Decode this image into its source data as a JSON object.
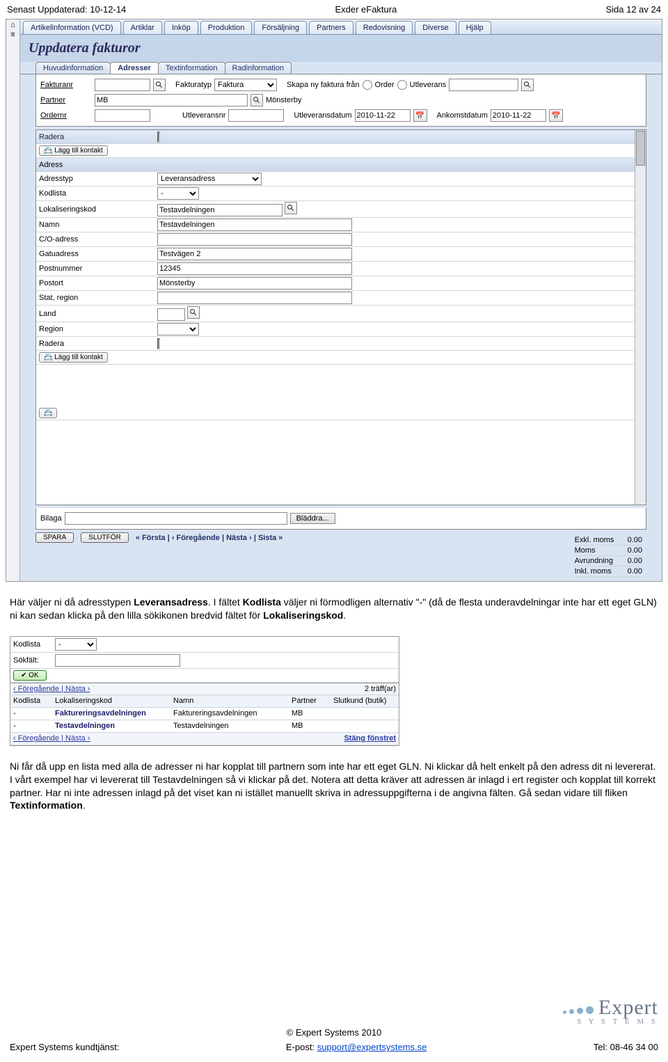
{
  "header": {
    "left": "Senast Uppdaterad: 10-12-14",
    "center": "Exder eFaktura",
    "right": "Sida 12 av 24"
  },
  "top_tabs": [
    "Artikelinformation (VCD)",
    "Artiklar",
    "Inköp",
    "Produktion",
    "Försäljning",
    "Partners",
    "Redovisning",
    "Diverse",
    "Hjälp"
  ],
  "page_title": "Uppdatera fakturor",
  "sub_tabs": [
    {
      "label": "Huvudinformation",
      "active": false
    },
    {
      "label": "Adresser",
      "active": true
    },
    {
      "label": "Textinformation",
      "active": false
    },
    {
      "label": "Radinformation",
      "active": false
    }
  ],
  "form": {
    "fakturanr_label": "Fakturanr",
    "fakturanr_value": "",
    "fakturatyp_label": "Fakturatyp",
    "fakturatyp_value": "Faktura",
    "skapa_label": "Skapa ny faktura från",
    "order_label": "Order",
    "utleverans_opt_label": "Utleverans",
    "partner_label": "Partner",
    "partner_value": "MB",
    "partner_name": "Mönsterby",
    "ordernr_label": "Ordernr",
    "ordernr_value": "",
    "utleveransnr_label": "Utleveransnr",
    "utleveransnr_value": "",
    "utleveransdatum_label": "Utleveransdatum",
    "utleveransdatum_value": "2010-11-22",
    "ankomstdatum_label": "Ankomstdatum",
    "ankomstdatum_value": "2010-11-22"
  },
  "grid": {
    "radera_label": "Radera",
    "lagg_till_kontakt": "Lägg till kontakt",
    "adress_header": "Adress",
    "rows": [
      {
        "label": "Adresstyp",
        "value": "Leveransadress",
        "type": "select"
      },
      {
        "label": "Kodlista",
        "value": "-",
        "type": "select-narrow"
      },
      {
        "label": "Lokaliseringskod",
        "value": "Testavdelningen",
        "type": "text-mag"
      },
      {
        "label": "Namn",
        "value": "Testavdelningen",
        "type": "text"
      },
      {
        "label": "C/O-adress",
        "value": "",
        "type": "text"
      },
      {
        "label": "Gatuadress",
        "value": "Testvägen 2",
        "type": "text"
      },
      {
        "label": "Postnummer",
        "value": "12345",
        "type": "text"
      },
      {
        "label": "Postort",
        "value": "Mönsterby",
        "type": "text"
      },
      {
        "label": "Stat, region",
        "value": "",
        "type": "text"
      },
      {
        "label": "Land",
        "value": "",
        "type": "text-mag-narrow"
      },
      {
        "label": "Region",
        "value": "",
        "type": "select-narrow"
      },
      {
        "label": "Radera",
        "value": "",
        "type": "check"
      }
    ]
  },
  "bilaga": {
    "label": "Bilaga",
    "browse": "Bläddra..."
  },
  "totals": [
    {
      "label": "Exkl. moms",
      "value": "0.00"
    },
    {
      "label": "Moms",
      "value": "0.00"
    },
    {
      "label": "Avrundning",
      "value": "0.00"
    },
    {
      "label": "Inkl. moms",
      "value": "0.00"
    }
  ],
  "bottom": {
    "spara": "SPARA",
    "slutfor": "SLUTFÖR",
    "nav": "« Första | ‹ Föregående | Nästa › | Sista »"
  },
  "body_text": {
    "p1a": "Här väljer ni då adresstypen ",
    "p1b_bold": "Leveransadress",
    "p1c": ". I fältet ",
    "p1d_bold": "Kodlista",
    "p1e": " väljer ni förmodligen alternativ \"-\" (då de flesta underavdelningar inte har ett eget GLN) ni kan sedan klicka på den lilla sökikonen bredvid fältet för ",
    "p1f_bold": "Lokaliseringskod",
    "p1g": "."
  },
  "popup": {
    "kodlista_label": "Kodlista",
    "kodlista_value": "-",
    "sokfalt_label": "Sökfält:",
    "ok": "OK",
    "nav": "‹ Föregående | Nästa ›",
    "hits": "2 träff(ar)",
    "cols": [
      "Kodlista",
      "Lokaliseringskod",
      "Namn",
      "Partner",
      "Slutkund (butik)"
    ],
    "rows": [
      {
        "kodlista": "-",
        "lok": "Faktureringsavdelningen",
        "namn": "Faktureringsavdelningen",
        "partner": "MB",
        "slut": ""
      },
      {
        "kodlista": "-",
        "lok": "Testavdelningen",
        "namn": "Testavdelningen",
        "partner": "MB",
        "slut": ""
      }
    ],
    "close": "Stäng fönstret"
  },
  "body_text2": {
    "p1": "Ni får då upp en lista med alla de adresser ni har kopplat till partnern som inte har ett eget GLN. Ni klickar då helt enkelt på den adress dit ni levererat. I vårt exempel har vi levererat till Testavdelningen så vi klickar på det. Notera att detta kräver att adressen är inlagd i ert register och kopplat till korrekt partner. Har ni inte adressen inlagd på det viset kan ni istället manuellt skriva in adressuppgifterna i de angivna fälten. Gå sedan vidare till fliken ",
    "p1_bold": "Textinformation",
    "p1_end": "."
  },
  "footer": {
    "copyright": "© Expert Systems 2010",
    "left": "Expert Systems kundtjänst:",
    "mid_label": "E-post: ",
    "mid_link": "support@expertsystems.se",
    "right": "Tel: 08-46 34 00",
    "logo_big": "Expert",
    "logo_small": "S Y S T E M S"
  }
}
